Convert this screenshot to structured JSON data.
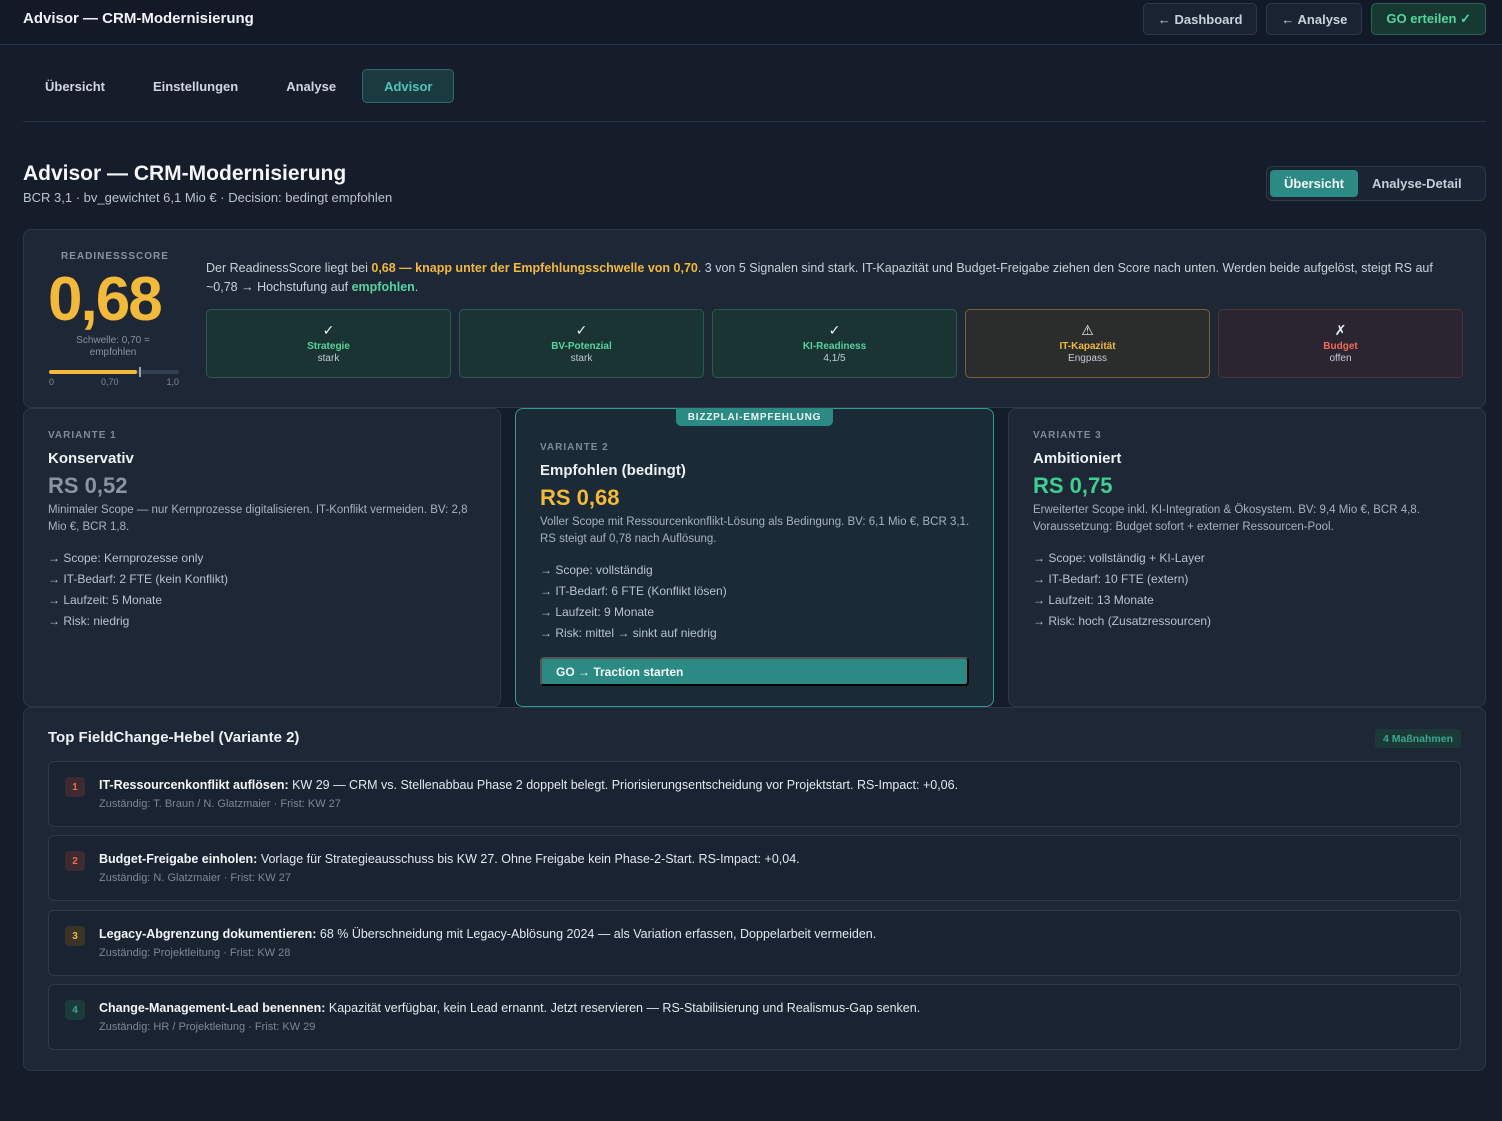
{
  "topbar": {
    "title": "Advisor — CRM-Modernisierung",
    "buttons": [
      "← Dashboard",
      "← Analyse",
      "GO erteilen ✓"
    ]
  },
  "tabs": [
    "Übersicht",
    "Einstellungen",
    "Analyse",
    "Advisor"
  ],
  "active_tab": "Advisor",
  "header": {
    "title": "Advisor — CRM-Modernisierung",
    "subtitle": "BCR 3,1 · bv_gewichtet 6,1 Mio € · Decision: bedingt empfohlen",
    "segments": [
      "Übersicht",
      "Analyse-Detail"
    ],
    "active_segment": "Übersicht"
  },
  "readiness": {
    "label": "READINESSSCORE",
    "value": "0,68",
    "score": 0.68,
    "threshold": 0.7,
    "threshold_text": "Schwelle: 0,70 = empfohlen",
    "ticks": [
      "0",
      "0,70",
      "1,0"
    ],
    "text_1": "Der ReadinessScore liegt bei ",
    "text_hl_1": "0,68 — knapp unter der Empfehlungsschwelle von 0,70",
    "text_2": ". 3 von 5 Signalen sind stark. IT-Kapazität und Budget-Freigabe ziehen den Score nach unten. Werden beide aufgelöst, steigt RS auf ~0,78 → Hochstufung auf ",
    "text_hl_2": "empfohlen",
    "text_3": ".",
    "signals": [
      {
        "icon": "✓",
        "name": "Strategie",
        "value": "stark",
        "status": "ok"
      },
      {
        "icon": "✓",
        "name": "BV-Potenzial",
        "value": "stark",
        "status": "ok"
      },
      {
        "icon": "✓",
        "name": "KI-Readiness",
        "value": "4,1/5",
        "status": "ok"
      },
      {
        "icon": "⚠",
        "name": "IT-Kapazität",
        "value": "Engpass",
        "status": "warn"
      },
      {
        "icon": "✗",
        "name": "Budget",
        "value": "offen",
        "status": "bad"
      }
    ]
  },
  "variants": [
    {
      "kicker": "VARIANTE 1",
      "name": "Konservativ",
      "rs": "RS 0,52",
      "desc": "Minimaler Scope — nur Kernprozesse digitalisieren. IT-Konflikt vermeiden. BV: 2,8 Mio €, BCR 1,8.",
      "items": [
        "→ Scope: Kernprozesse only",
        "→ IT-Bedarf: 2 FTE (kein Konflikt)",
        "→ Laufzeit: 5 Monate",
        "→ Risk: niedrig"
      ]
    },
    {
      "badge": "BIZZPLAI-EMPFEHLUNG",
      "kicker": "VARIANTE 2",
      "name": "Empfohlen (bedingt)",
      "rs": "RS 0,68",
      "desc": "Voller Scope mit Ressourcenkonflikt-Lösung als Bedingung. BV: 6,1 Mio €, BCR 3,1. RS steigt auf 0,78 nach Auflösung.",
      "items": [
        "→ Scope: vollständig",
        "→ IT-Bedarf: 6 FTE (Konflikt lösen)",
        "→ Laufzeit: 9 Monate",
        "→ Risk: mittel → sinkt auf niedrig"
      ],
      "cta": "GO → Traction starten"
    },
    {
      "kicker": "VARIANTE 3",
      "name": "Ambitioniert",
      "rs": "RS 0,75",
      "desc": "Erweiterter Scope inkl. KI-Integration & Ökosystem. BV: 9,4 Mio €, BCR 4,8. Voraussetzung: Budget sofort + externer Ressourcen-Pool.",
      "items": [
        "→ Scope: vollständig + KI-Layer",
        "→ IT-Bedarf: 10 FTE (extern)",
        "→ Laufzeit: 13 Monate",
        "→ Risk: hoch (Zusatzressourcen)"
      ]
    }
  ],
  "hebel": {
    "title": "Top FieldChange-Hebel (Variante 2)",
    "count": "4 Maßnahmen",
    "items": [
      {
        "num": "1",
        "title": "IT-Ressourcenkonflikt auflösen:",
        "text": " KW 29 — CRM vs. Stellenabbau Phase 2 doppelt belegt. Priorisierungsentscheidung vor Projektstart. RS-Impact: +0,06.",
        "meta": "Zuständig: T. Braun / N. Glatzmaier · Frist: KW 27"
      },
      {
        "num": "2",
        "title": "Budget-Freigabe einholen:",
        "text": " Vorlage für Strategieausschuss bis KW 27. Ohne Freigabe kein Phase-2-Start. RS-Impact: +0,04.",
        "meta": "Zuständig: N. Glatzmaier · Frist: KW 27"
      },
      {
        "num": "3",
        "title": "Legacy-Abgrenzung dokumentieren:",
        "text": " 68 % Überschneidung mit Legacy-Ablösung 2024 — als Variation erfassen, Doppelarbeit vermeiden.",
        "meta": "Zuständig: Projektleitung · Frist: KW 28"
      },
      {
        "num": "4",
        "title": "Change-Management-Lead benennen:",
        "text": " Kapazität verfügbar, kein Lead ernannt. Jetzt reservieren — RS-Stabilisierung und Realismus-Gap senken.",
        "meta": "Zuständig: HR / Projektleitung · Frist: KW 29"
      }
    ]
  },
  "colors": {
    "accent": "#2b8a84",
    "warn": "#f2b93b",
    "ok": "#55d59e",
    "bad": "#f06b5d"
  }
}
